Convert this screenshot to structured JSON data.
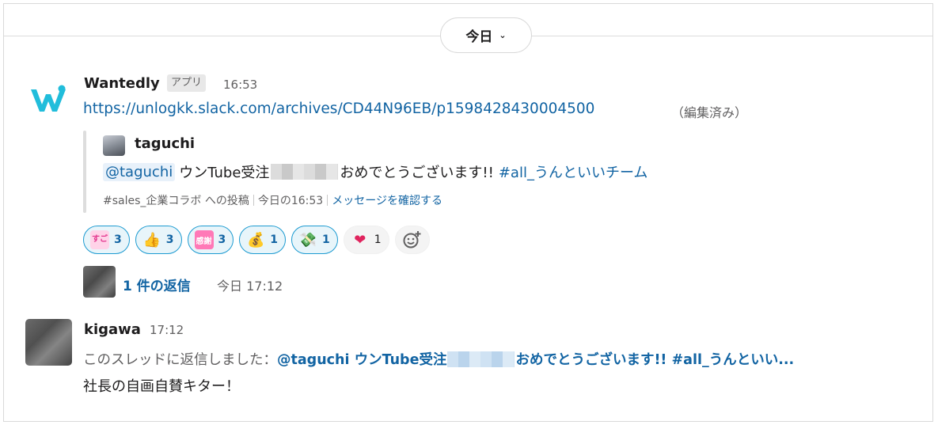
{
  "date_divider": {
    "label": "今日"
  },
  "message1": {
    "sender": "Wantedly",
    "badge": "アプリ",
    "time": "16:53",
    "link": "https://unlogkk.slack.com/archives/CD44N96EB/p1598428430004500",
    "edited": "（編集済み）",
    "attachment": {
      "author": "taguchi",
      "mention": "@taguchi",
      "text_before": "ウンTube受注",
      "text_after": "おめでとうございます!!",
      "channel": "#all_うんといいチーム",
      "footer_channel": "#sales_企業コラボ への投稿",
      "footer_time": "今日の16:53",
      "footer_view": "メッセージを確認する"
    },
    "reactions": [
      {
        "icon": "sugoi-emoji",
        "glyph": "すご",
        "count": "3"
      },
      {
        "icon": "thumbs-up-emoji",
        "glyph": "👍",
        "count": "3"
      },
      {
        "icon": "kansha-emoji",
        "glyph": "感謝",
        "count": "3"
      },
      {
        "icon": "money-bag-emoji",
        "glyph": "💰",
        "count": "1"
      },
      {
        "icon": "money-with-wings-emoji",
        "glyph": "💸",
        "count": "1"
      },
      {
        "icon": "heart-emoji",
        "glyph": "❤",
        "count": "1"
      }
    ],
    "thread": {
      "reply_count": "1 件の返信",
      "reply_time": "今日 17:12"
    }
  },
  "message2": {
    "sender": "kigawa",
    "time": "17:12",
    "reply_prefix": "このスレッドに返信しました：",
    "quoted_before": "@taguchi ウンTube受注",
    "quoted_after": "おめでとうございます!! #all_うんといい...",
    "body": "社長の自画自賛キター！"
  },
  "colors": {
    "link": "#1264a3",
    "reaction_border": "#1d9bd1",
    "reaction_bg": "#e8f5fa",
    "heart": "#e0245e"
  }
}
